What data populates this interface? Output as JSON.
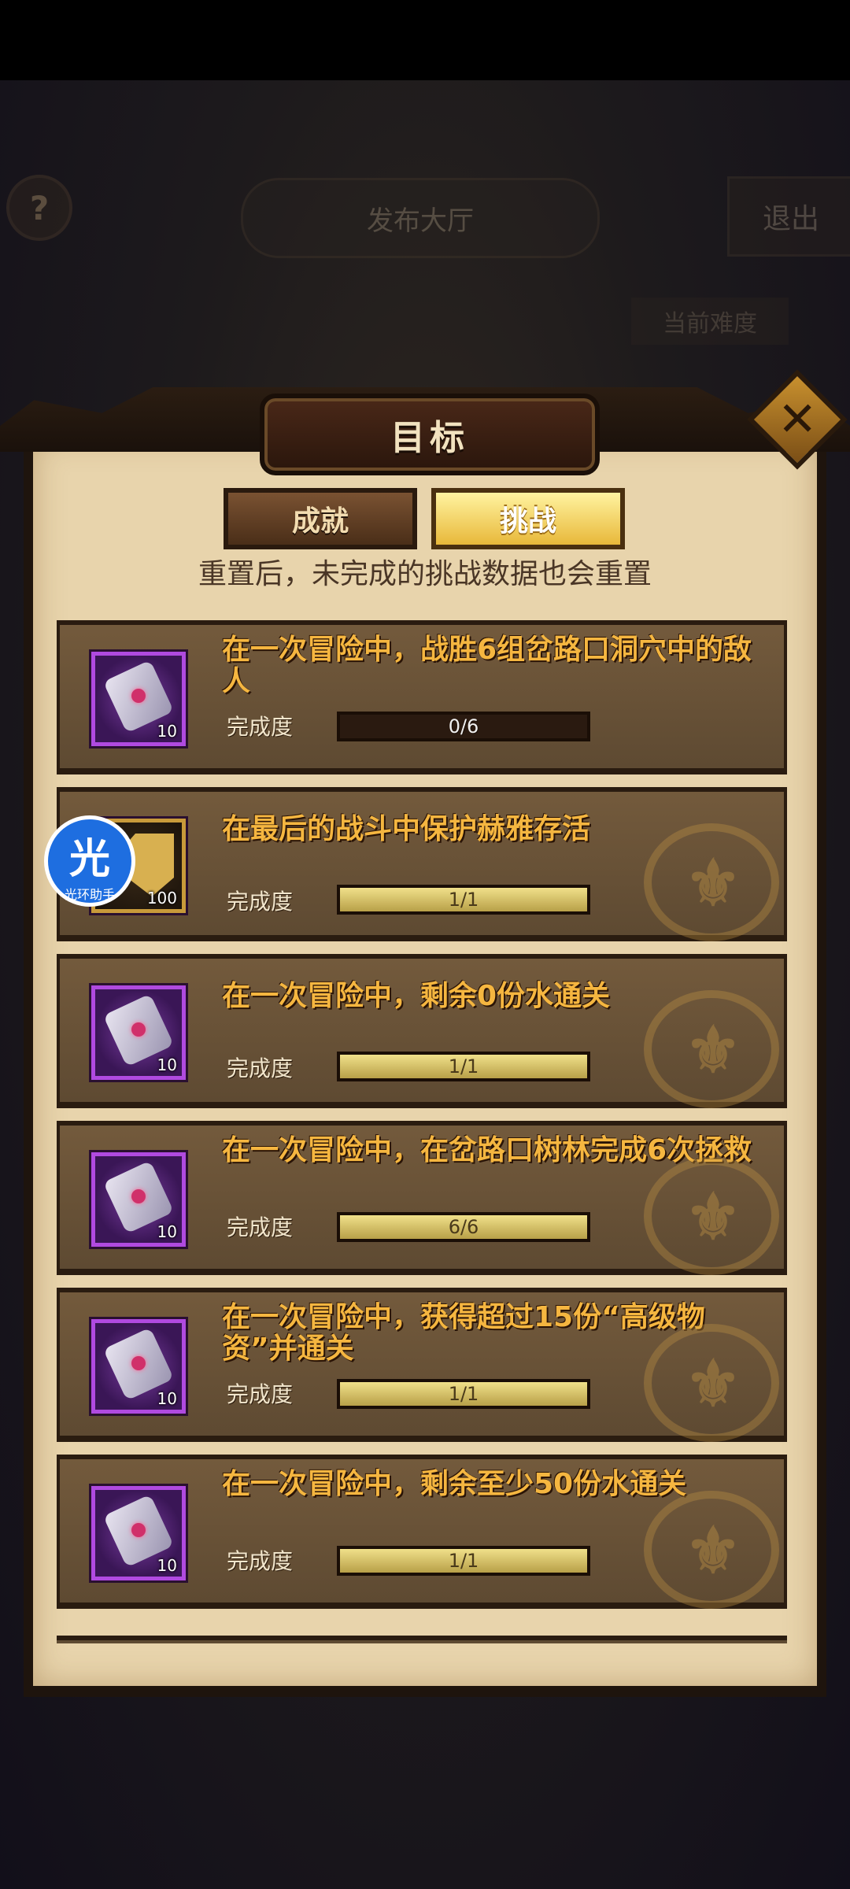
{
  "background": {
    "help_label": "?",
    "top_pill_label": "发布大厅",
    "top_right_button": "退出",
    "top_right_tab": "当前难度"
  },
  "panel": {
    "title": "目标",
    "close_label": "✕",
    "tabs": [
      {
        "label": "成就",
        "selected": false
      },
      {
        "label": "挑战",
        "selected": true
      }
    ],
    "notice": "重置后，未完成的挑战数据也会重置"
  },
  "challenges": [
    {
      "title": "在一次冒险中，战胜6组岔路口洞穴中的敌人",
      "reward_icon": "scroll-icon",
      "reward_count": "10",
      "progress_label": "完成度",
      "progress_text": "0/6",
      "progress": 0.0,
      "completed": false
    },
    {
      "title": "在最后的战斗中保护赫雅存活",
      "reward_icon": "gold-icon",
      "reward_count": "100",
      "progress_label": "完成度",
      "progress_text": "1/1",
      "progress": 1.0,
      "completed": true
    },
    {
      "title": "在一次冒险中，剩余0份水通关",
      "reward_icon": "scroll-icon",
      "reward_count": "10",
      "progress_label": "完成度",
      "progress_text": "1/1",
      "progress": 1.0,
      "completed": true
    },
    {
      "title": "在一次冒险中，在岔路口树林完成6次拯救",
      "reward_icon": "scroll-icon",
      "reward_count": "10",
      "progress_label": "完成度",
      "progress_text": "6/6",
      "progress": 1.0,
      "completed": true
    },
    {
      "title": "在一次冒险中，获得超过15份“高级物资”并通关",
      "reward_icon": "scroll-icon",
      "reward_count": "10",
      "progress_label": "完成度",
      "progress_text": "1/1",
      "progress": 1.0,
      "completed": true
    },
    {
      "title": "在一次冒险中，剩余至少50份水通关",
      "reward_icon": "scroll-icon",
      "reward_count": "10",
      "progress_label": "完成度",
      "progress_text": "1/1",
      "progress": 1.0,
      "completed": true
    }
  ],
  "overlay_badge": {
    "char": "光",
    "label": "光环助手",
    "color": "#1e6ee0"
  }
}
